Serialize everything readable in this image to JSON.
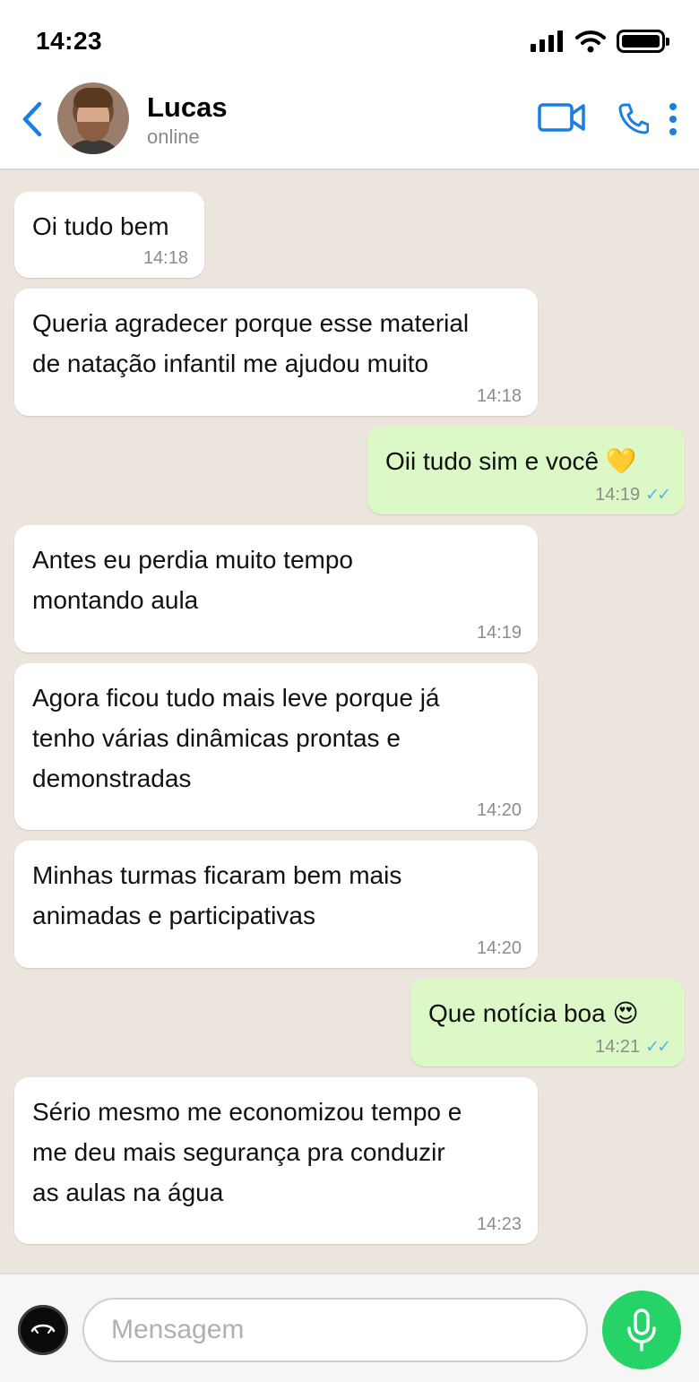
{
  "status_bar": {
    "time": "14:23"
  },
  "header": {
    "contact_name": "Lucas",
    "contact_status": "online"
  },
  "messages": [
    {
      "direction": "in",
      "text": "Oi tudo bem",
      "time": "14:18"
    },
    {
      "direction": "in",
      "text": "Queria agradecer porque esse material\nde natação infantil me ajudou muito",
      "time": "14:18"
    },
    {
      "direction": "out",
      "text": "Oii tudo sim e você",
      "emoji": "💛",
      "time": "14:19",
      "ticks": "✓✓"
    },
    {
      "direction": "in",
      "text": "Antes eu perdia muito tempo\nmontando aula",
      "time": "14:19"
    },
    {
      "direction": "in",
      "text": "Agora ficou tudo mais leve porque já\ntenho várias dinâmicas prontas e\ndemonstradas",
      "time": "14:20"
    },
    {
      "direction": "in",
      "text": "Minhas turmas ficaram bem mais\nanimadas e participativas",
      "time": "14:20"
    },
    {
      "direction": "out",
      "text": "Que notícia boa",
      "emoji": "😍",
      "time": "14:21",
      "ticks": "✓✓"
    },
    {
      "direction": "in",
      "text": "Sério mesmo me economizou tempo e\nme deu mais segurança pra conduzir\nas aulas na água",
      "time": "14:23"
    }
  ],
  "input": {
    "placeholder": "Mensagem",
    "value": ""
  },
  "colors": {
    "accent": "#1a7fe0",
    "outgoing_bubble": "#dcf8c6",
    "chat_background": "#ece5dd",
    "mic_button": "#25d366",
    "read_ticks": "#4fb6ec"
  },
  "icons": {
    "back": "chevron-left-icon",
    "video": "video-camera-icon",
    "call": "phone-icon",
    "more": "more-vertical-icon",
    "emoji": "emoji-icon",
    "mic": "microphone-icon"
  }
}
